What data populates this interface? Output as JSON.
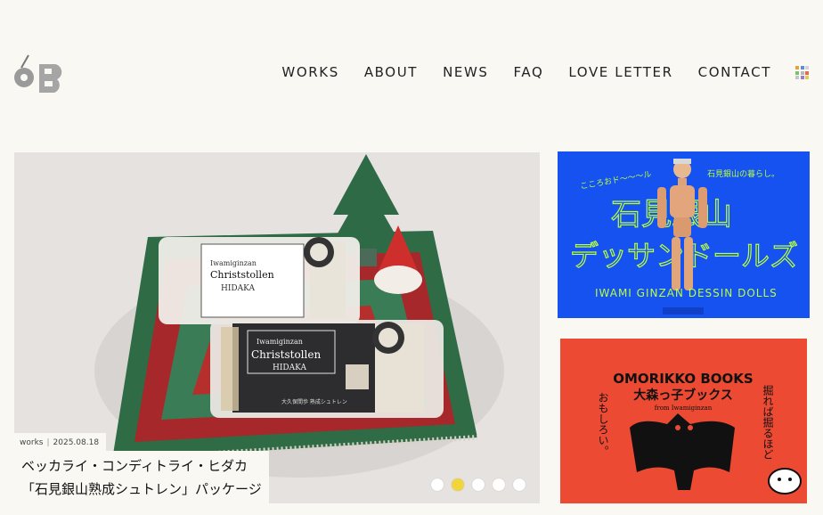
{
  "nav": {
    "items": [
      "WORKS",
      "ABOUT",
      "NEWS",
      "FAQ",
      "LOVE LETTER",
      "CONTACT"
    ]
  },
  "colors": {
    "background": "#faf8f3",
    "active_dot": "#f2d53c",
    "banner_blue": "#1652f0",
    "banner_red": "#ec4a33",
    "banner_blue_text": "#b8ff3c"
  },
  "slider": {
    "category": "works",
    "date": "2025.08.18",
    "title_line1": "ベッカライ・コンディトライ・ヒダカ",
    "title_line2": "「石見銀山熟成シュトレン」パッケージ",
    "slide_count": 5,
    "active_slide": 2,
    "package_texts": {
      "brand_small": "Iwamiginzan",
      "product": "Christstollen",
      "maker": "HIDAKA",
      "jp_small": "大久保間歩 熟成シュトレン"
    }
  },
  "banners": {
    "dessin_dolls": {
      "top_left": "こころおド〜〜〜ル",
      "top_right": "石見銀山の暮らし。",
      "title_line1": "石見銀山",
      "title_line2": "デッサンドールズ",
      "subtitle": "IWAMI GINZAN DESSIN DOLLS"
    },
    "omorikko_books": {
      "title_en": "OMORIKKO BOOKS",
      "title_jp": "大森っ子ブックス",
      "from": "from Iwamiginzan",
      "left_vertical": "おもしろい。",
      "right_vertical": "掘れば掘るほど"
    }
  }
}
